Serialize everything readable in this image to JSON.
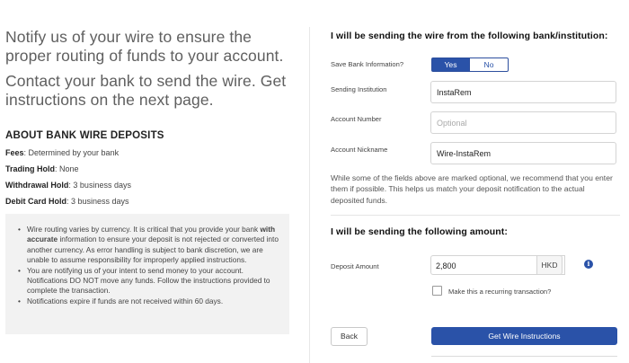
{
  "intro": {
    "line1": "Notify us of your wire to ensure the proper routing of funds to your account.",
    "line2": "Contact your bank to send the wire. Get instructions on the next page."
  },
  "about": {
    "title": "ABOUT BANK WIRE DEPOSITS",
    "items": [
      {
        "label": "Fees",
        "value": ": Determined by your bank"
      },
      {
        "label": "Trading Hold",
        "value": ": None"
      },
      {
        "label": "Withdrawal Hold",
        "value": ": 3 business days"
      },
      {
        "label": "Debit Card Hold",
        "value": ": 3 business days"
      }
    ]
  },
  "notice": {
    "b1_pre": "Wire routing varies by currency. It is critical that you provide your bank ",
    "b1_bold": "with accurate",
    "b1_post": " information to ensure your deposit is not rejected or converted into another currency. As error handling is subject to bank discretion, we are unable to assume responsibility for improperly applied instructions.",
    "b2": "You are notifying us of your intent to send money to your account. Notifications DO NOT move any funds. Follow the instructions provided to complete the transaction.",
    "b3": "Notifications expire if funds are not received within 60 days."
  },
  "bank": {
    "title": "I will be sending the wire from the following bank/institution:",
    "save_label": "Save Bank Information?",
    "yes": "Yes",
    "no": "No",
    "institution_label": "Sending Institution",
    "institution_value": "InstaRem",
    "account_number_label": "Account Number",
    "account_number_placeholder": "Optional",
    "nickname_label": "Account Nickname",
    "nickname_value": "Wire-InstaRem",
    "note": "While some of the fields above are marked optional, we recommend that you enter them if possible. This helps us match your deposit notification to the actual deposited funds."
  },
  "amount": {
    "title": "I will be sending the following amount:",
    "label": "Deposit Amount",
    "value": "2,800",
    "currency": "HKD",
    "info_icon": "i",
    "recurring_label": "Make this a recurring transaction?"
  },
  "actions": {
    "back": "Back",
    "submit": "Get Wire Instructions"
  },
  "colors": {
    "accent": "#2a52a8",
    "panel": "#f2f2f2"
  }
}
